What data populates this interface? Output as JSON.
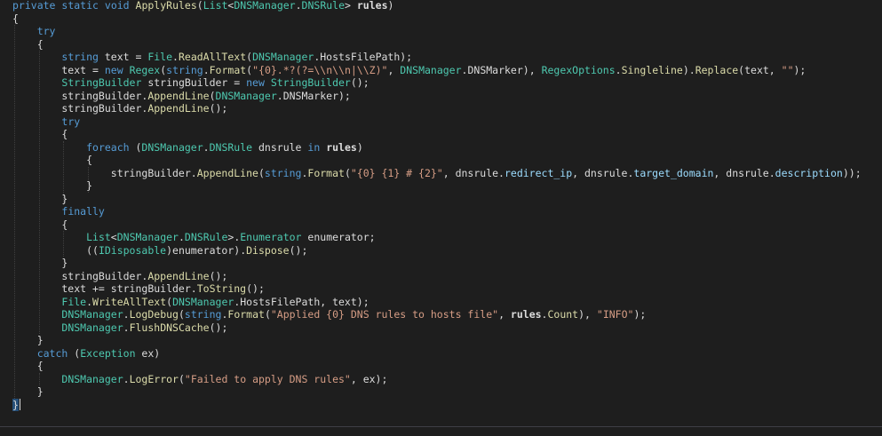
{
  "editor": {
    "language": "C#",
    "theme_background": "#1e1e1e",
    "colors": {
      "keyword": "#569cd6",
      "type": "#4ec9b0",
      "method": "#dcdcaa",
      "string": "#d69d85",
      "plain": "#dcdcdc"
    },
    "lines": [
      [
        {
          "t": "private",
          "c": "kw"
        },
        {
          "t": " "
        },
        {
          "t": "static",
          "c": "kw"
        },
        {
          "t": " "
        },
        {
          "t": "void",
          "c": "kw"
        },
        {
          "t": " "
        },
        {
          "t": "ApplyRules",
          "c": "mt"
        },
        {
          "t": "("
        },
        {
          "t": "List",
          "c": "ty"
        },
        {
          "t": "<"
        },
        {
          "t": "DNSManager",
          "c": "ty"
        },
        {
          "t": "."
        },
        {
          "t": "DNSRule",
          "c": "ty"
        },
        {
          "t": "> "
        },
        {
          "t": "rules",
          "c": "bd"
        },
        {
          "t": ")"
        }
      ],
      [
        {
          "t": "{"
        }
      ],
      [
        {
          "t": "    "
        },
        {
          "t": "try",
          "c": "kw"
        }
      ],
      [
        {
          "t": "    {"
        }
      ],
      [
        {
          "t": "        "
        },
        {
          "t": "string",
          "c": "kw"
        },
        {
          "t": " text = "
        },
        {
          "t": "File",
          "c": "ty"
        },
        {
          "t": "."
        },
        {
          "t": "ReadAllText",
          "c": "mt"
        },
        {
          "t": "("
        },
        {
          "t": "DNSManager",
          "c": "ty"
        },
        {
          "t": ".HostsFilePath);"
        }
      ],
      [
        {
          "t": "        text = "
        },
        {
          "t": "new",
          "c": "kw"
        },
        {
          "t": " "
        },
        {
          "t": "Regex",
          "c": "ty"
        },
        {
          "t": "("
        },
        {
          "t": "string",
          "c": "kw"
        },
        {
          "t": "."
        },
        {
          "t": "Format",
          "c": "mt"
        },
        {
          "t": "("
        },
        {
          "t": "\"{0}.*?(?=\\\\n\\\\n|\\\\Z)\"",
          "c": "st"
        },
        {
          "t": ", "
        },
        {
          "t": "DNSManager",
          "c": "ty"
        },
        {
          "t": ".DNSMarker), "
        },
        {
          "t": "RegexOptions",
          "c": "ty"
        },
        {
          "t": "."
        },
        {
          "t": "Singleline",
          "c": "mt"
        },
        {
          "t": ")."
        },
        {
          "t": "Replace",
          "c": "mt"
        },
        {
          "t": "(text, "
        },
        {
          "t": "\"\"",
          "c": "st"
        },
        {
          "t": ");"
        }
      ],
      [
        {
          "t": "        "
        },
        {
          "t": "StringBuilder",
          "c": "ty"
        },
        {
          "t": " stringBuilder = "
        },
        {
          "t": "new",
          "c": "kw"
        },
        {
          "t": " "
        },
        {
          "t": "StringBuilder",
          "c": "ty"
        },
        {
          "t": "();"
        }
      ],
      [
        {
          "t": "        stringBuilder."
        },
        {
          "t": "AppendLine",
          "c": "mt"
        },
        {
          "t": "("
        },
        {
          "t": "DNSManager",
          "c": "ty"
        },
        {
          "t": ".DNSMarker);"
        }
      ],
      [
        {
          "t": "        stringBuilder."
        },
        {
          "t": "AppendLine",
          "c": "mt"
        },
        {
          "t": "();"
        }
      ],
      [
        {
          "t": "        "
        },
        {
          "t": "try",
          "c": "kw"
        }
      ],
      [
        {
          "t": "        {"
        }
      ],
      [
        {
          "t": "            "
        },
        {
          "t": "foreach",
          "c": "kw"
        },
        {
          "t": " ("
        },
        {
          "t": "DNSManager",
          "c": "ty"
        },
        {
          "t": "."
        },
        {
          "t": "DNSRule",
          "c": "ty"
        },
        {
          "t": " dnsrule "
        },
        {
          "t": "in",
          "c": "kw"
        },
        {
          "t": " "
        },
        {
          "t": "rules",
          "c": "bd"
        },
        {
          "t": ")"
        }
      ],
      [
        {
          "t": "            {"
        }
      ],
      [
        {
          "t": "                stringBuilder."
        },
        {
          "t": "AppendLine",
          "c": "mt"
        },
        {
          "t": "("
        },
        {
          "t": "string",
          "c": "kw"
        },
        {
          "t": "."
        },
        {
          "t": "Format",
          "c": "mt"
        },
        {
          "t": "("
        },
        {
          "t": "\"{0} {1} # {2}\"",
          "c": "st"
        },
        {
          "t": ", dnsrule."
        },
        {
          "t": "redirect_ip",
          "c": "mem"
        },
        {
          "t": ", dnsrule."
        },
        {
          "t": "target_domain",
          "c": "mem"
        },
        {
          "t": ", dnsrule."
        },
        {
          "t": "description",
          "c": "mem"
        },
        {
          "t": "));"
        }
      ],
      [
        {
          "t": "            }"
        }
      ],
      [
        {
          "t": "        }"
        }
      ],
      [
        {
          "t": "        "
        },
        {
          "t": "finally",
          "c": "kw"
        }
      ],
      [
        {
          "t": "        {"
        }
      ],
      [
        {
          "t": "            "
        },
        {
          "t": "List",
          "c": "ty"
        },
        {
          "t": "<"
        },
        {
          "t": "DNSManager",
          "c": "ty"
        },
        {
          "t": "."
        },
        {
          "t": "DNSRule",
          "c": "ty"
        },
        {
          "t": ">."
        },
        {
          "t": "Enumerator",
          "c": "ty"
        },
        {
          "t": " enumerator;"
        }
      ],
      [
        {
          "t": "            (("
        },
        {
          "t": "IDisposable",
          "c": "ty"
        },
        {
          "t": ")enumerator)."
        },
        {
          "t": "Dispose",
          "c": "mt"
        },
        {
          "t": "();"
        }
      ],
      [
        {
          "t": "        }"
        }
      ],
      [
        {
          "t": "        stringBuilder."
        },
        {
          "t": "AppendLine",
          "c": "mt"
        },
        {
          "t": "();"
        }
      ],
      [
        {
          "t": "        text += stringBuilder."
        },
        {
          "t": "ToString",
          "c": "mt"
        },
        {
          "t": "();"
        }
      ],
      [
        {
          "t": "        "
        },
        {
          "t": "File",
          "c": "ty"
        },
        {
          "t": "."
        },
        {
          "t": "WriteAllText",
          "c": "mt"
        },
        {
          "t": "("
        },
        {
          "t": "DNSManager",
          "c": "ty"
        },
        {
          "t": ".HostsFilePath, text);"
        }
      ],
      [
        {
          "t": "        "
        },
        {
          "t": "DNSManager",
          "c": "ty"
        },
        {
          "t": "."
        },
        {
          "t": "LogDebug",
          "c": "mt"
        },
        {
          "t": "("
        },
        {
          "t": "string",
          "c": "kw"
        },
        {
          "t": "."
        },
        {
          "t": "Format",
          "c": "mt"
        },
        {
          "t": "("
        },
        {
          "t": "\"Applied {0} DNS rules to hosts file\"",
          "c": "st"
        },
        {
          "t": ", "
        },
        {
          "t": "rules",
          "c": "bd"
        },
        {
          "t": "."
        },
        {
          "t": "Count",
          "c": "mt"
        },
        {
          "t": "), "
        },
        {
          "t": "\"INFO\"",
          "c": "st"
        },
        {
          "t": ");"
        }
      ],
      [
        {
          "t": "        "
        },
        {
          "t": "DNSManager",
          "c": "ty"
        },
        {
          "t": "."
        },
        {
          "t": "FlushDNSCache",
          "c": "mt"
        },
        {
          "t": "();"
        }
      ],
      [
        {
          "t": "    }"
        }
      ],
      [
        {
          "t": "    "
        },
        {
          "t": "catch",
          "c": "kw"
        },
        {
          "t": " ("
        },
        {
          "t": "Exception",
          "c": "ty"
        },
        {
          "t": " ex)"
        }
      ],
      [
        {
          "t": "    {"
        }
      ],
      [
        {
          "t": "        "
        },
        {
          "t": "DNSManager",
          "c": "ty"
        },
        {
          "t": "."
        },
        {
          "t": "LogError",
          "c": "mt"
        },
        {
          "t": "("
        },
        {
          "t": "\"Failed to apply DNS rules\"",
          "c": "st"
        },
        {
          "t": ", ex);"
        }
      ],
      [
        {
          "t": "    }"
        }
      ],
      [
        {
          "t": "}",
          "cursor": true
        }
      ]
    ]
  }
}
